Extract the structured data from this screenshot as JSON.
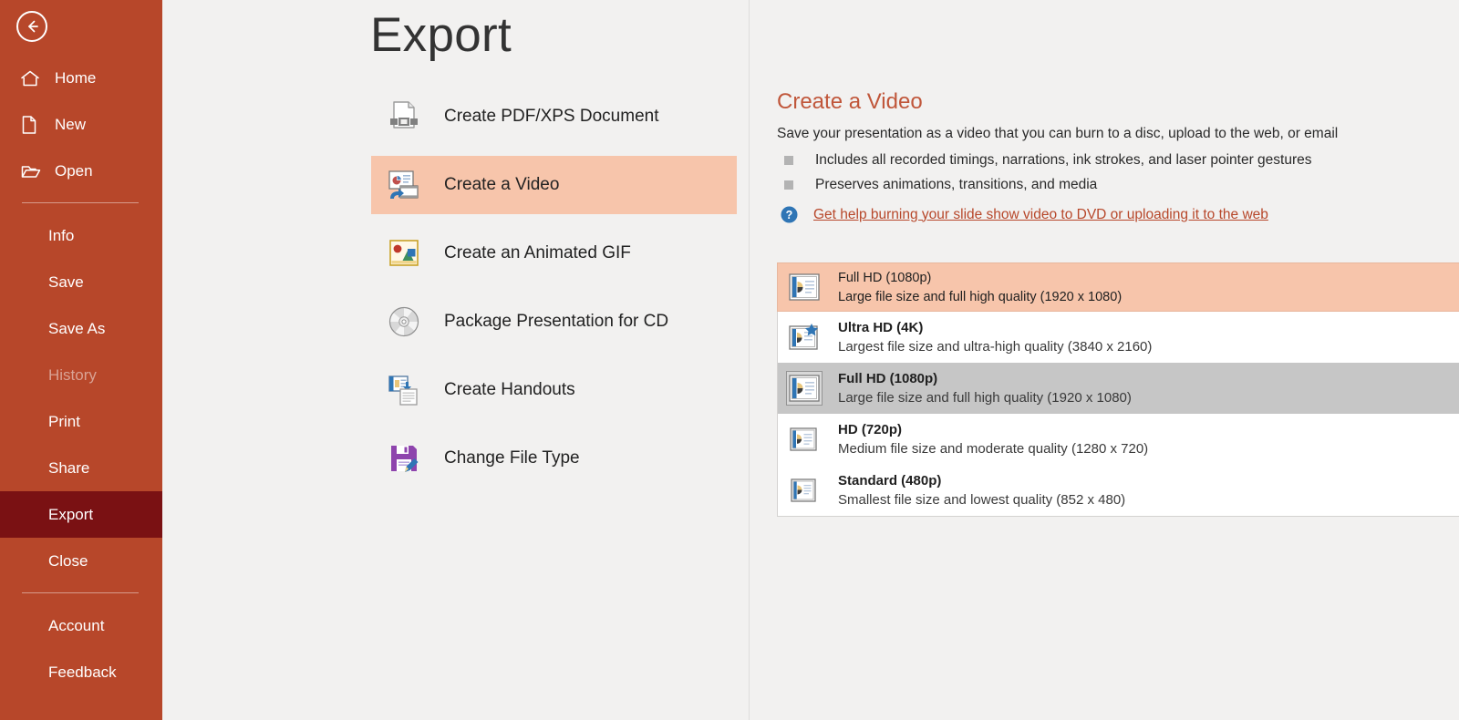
{
  "window": {
    "page_title": "Export",
    "back_button": "back-arrow"
  },
  "sidebar": {
    "background_color": "#b7472a",
    "active_color": "#7a1113",
    "top_items": [
      {
        "label": "Home",
        "icon": "home-icon"
      },
      {
        "label": "New",
        "icon": "new-document-icon"
      },
      {
        "label": "Open",
        "icon": "open-folder-icon"
      }
    ],
    "middle_items": [
      {
        "label": "Info",
        "state": "normal"
      },
      {
        "label": "Save",
        "state": "normal"
      },
      {
        "label": "Save As",
        "state": "normal"
      },
      {
        "label": "History",
        "state": "disabled"
      },
      {
        "label": "Print",
        "state": "normal"
      },
      {
        "label": "Share",
        "state": "normal"
      },
      {
        "label": "Export",
        "state": "active"
      },
      {
        "label": "Close",
        "state": "normal"
      }
    ],
    "bottom_items": [
      {
        "label": "Account"
      },
      {
        "label": "Feedback"
      }
    ]
  },
  "export_options": {
    "selected_index": 1,
    "highlight_color": "#f7c5ab",
    "items": [
      {
        "label": "Create PDF/XPS Document",
        "icon": "pdf-document-icon"
      },
      {
        "label": "Create a Video",
        "icon": "create-video-icon"
      },
      {
        "label": "Create an Animated GIF",
        "icon": "animated-gif-icon"
      },
      {
        "label": "Package Presentation for CD",
        "icon": "cd-disc-icon"
      },
      {
        "label": "Create Handouts",
        "icon": "handouts-icon"
      },
      {
        "label": "Change File Type",
        "icon": "change-file-type-icon"
      }
    ]
  },
  "detail": {
    "title": "Create a Video",
    "title_color": "#c0563a",
    "subtitle": "Save your presentation as a video that you can burn to a disc, upload to the web, or email",
    "bullets": [
      "Includes all recorded timings, narrations, ink strokes, and laser pointer gestures",
      "Preserves animations, transitions, and media"
    ],
    "help_link": "Get help burning your slide show video to DVD or uploading it to the web",
    "help_icon": "question-mark-icon"
  },
  "resolution_combo": {
    "expanded": true,
    "selected": {
      "title": "Full HD (1080p)",
      "description": "Large file size and full high quality (1920 x 1080)"
    },
    "caret_icon": "chevron-down-icon",
    "highlighted_index": 1,
    "options": [
      {
        "title": "Ultra HD (4K)",
        "description": "Largest file size and ultra-high quality (3840 x 2160)",
        "icon": "slide-4k-star-icon"
      },
      {
        "title": "Full HD (1080p)",
        "description": "Large file size and full high quality (1920 x 1080)",
        "icon": "slide-1080p-icon"
      },
      {
        "title": "HD (720p)",
        "description": "Medium file size and moderate quality (1280 x 720)",
        "icon": "slide-720p-icon"
      },
      {
        "title": "Standard (480p)",
        "description": "Smallest file size and lowest quality (852 x 480)",
        "icon": "slide-480p-icon"
      }
    ]
  }
}
